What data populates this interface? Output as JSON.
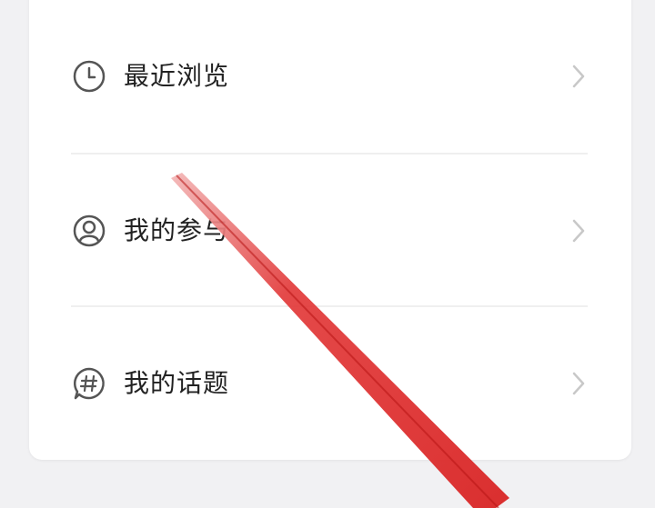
{
  "menu": {
    "items": [
      {
        "label": "最近浏览",
        "icon": "clock-icon"
      },
      {
        "label": "我的参与",
        "icon": "user-avatar-icon"
      },
      {
        "label": "我的话题",
        "icon": "hashtag-chat-icon"
      }
    ]
  },
  "colors": {
    "background": "#f1f1f3",
    "card": "#ffffff",
    "text": "#222222",
    "icon": "#555555",
    "chevron": "#c8c8c8",
    "annotation_arrow": "#e02424"
  }
}
